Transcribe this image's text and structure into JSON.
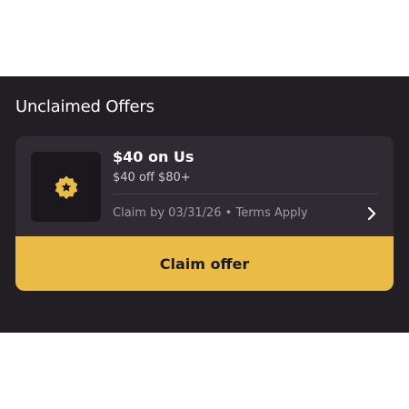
{
  "section": {
    "title": "Unclaimed Offers"
  },
  "offer": {
    "icon": "star-badge-icon",
    "title": "$40 on Us",
    "subtitle": "$40 off $80+",
    "terms": "Claim by 03/31/26 • Terms Apply",
    "chevron_icon": "chevron-right-icon",
    "button_label": "Claim offer"
  },
  "colors": {
    "panel_background": "#221f24",
    "card_background": "#302b33",
    "accent": "#ebbc45"
  }
}
